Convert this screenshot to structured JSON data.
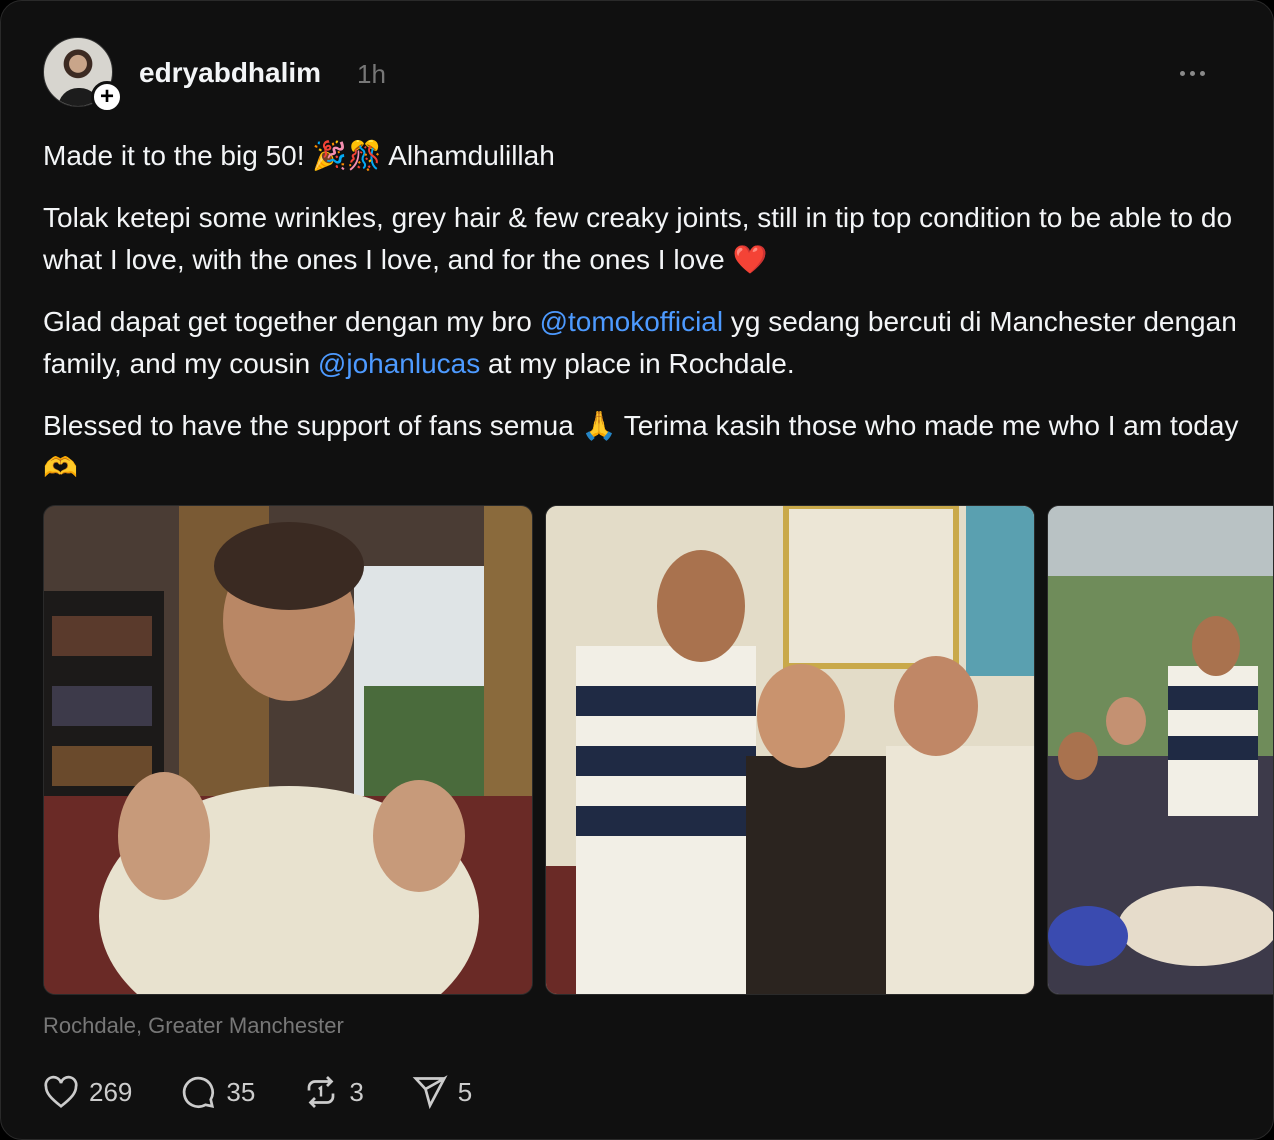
{
  "post": {
    "username": "edryabdhalim",
    "time": "1h",
    "paragraph1": {
      "text": "Made it to the big 50! ",
      "emoji": "🎉🎊",
      "tail": " Alhamdulillah"
    },
    "paragraph2": {
      "text": "Tolak ketepi some wrinkles, grey hair & few creaky joints, still in tip top condition to be able to do what I love, with the ones I love, and for the ones I love ",
      "emoji": "❤️"
    },
    "paragraph3": {
      "part1": "Glad dapat get together dengan my bro ",
      "mention1": "@tomokofficial",
      "part2": " yg sedang bercuti di Manchester dengan family, and my cousin ",
      "mention2": "@johanlucas",
      "part3": " at my place in Rochdale."
    },
    "paragraph4": {
      "part1": "Blessed to have the support of fans semua ",
      "emoji1": "🙏",
      "part2": " Terima kasih those who made me who I am today ",
      "emoji2": "🫶"
    },
    "location": "Rochdale, Greater Manchester"
  },
  "actions": {
    "likes": "269",
    "comments": "35",
    "reposts": "3",
    "shares": "5"
  },
  "colors": {
    "background": "#101010",
    "mention": "#4d9aff",
    "muted": "#777777"
  },
  "icons": {
    "like": "heart-icon",
    "comment": "comment-icon",
    "repost": "repost-icon",
    "share": "send-icon",
    "more": "more-icon"
  }
}
